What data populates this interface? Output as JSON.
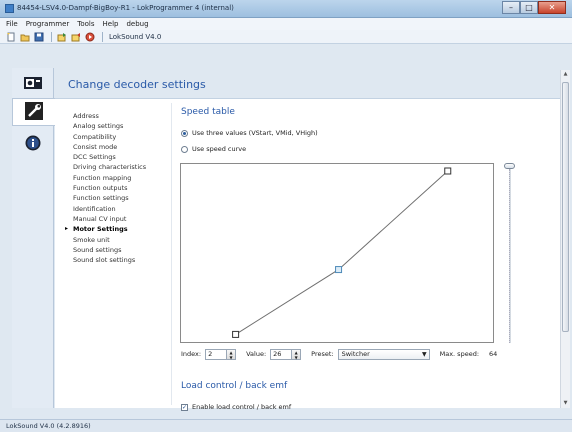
{
  "window": {
    "title": "84454-LSV4.0-Dampf-BigBoy-R1 - LokProgrammer 4 (internal)",
    "controls": [
      "minimize",
      "maximize",
      "close"
    ]
  },
  "menu": [
    "File",
    "Programmer",
    "Tools",
    "Help",
    "debug"
  ],
  "toolbar": {
    "label": "LokSound V4.0",
    "icons": [
      "new-icon",
      "open-icon",
      "save-icon",
      "read-icon",
      "write-icon",
      "run-icon"
    ]
  },
  "rail": {
    "tabs": [
      "decoder-settings-icon",
      "info-icon"
    ]
  },
  "header": {
    "title": "Change decoder settings"
  },
  "nav": {
    "items": [
      "Address",
      "Analog settings",
      "Compatibility",
      "Consist mode",
      "DCC Settings",
      "Driving characteristics",
      "Function mapping",
      "Function outputs",
      "Function settings",
      "Identification",
      "Manual CV input",
      "Motor Settings",
      "Smoke unit",
      "Sound settings",
      "Sound slot settings"
    ],
    "active_index": 11
  },
  "speed_table": {
    "title": "Speed table",
    "option_three_values": "Use three values (VStart, VMid, VHigh)",
    "option_curve": "Use speed curve",
    "selected_option": "three_values",
    "points": [
      {
        "index": 1,
        "value": 1
      },
      {
        "index": 2,
        "value": 26
      },
      {
        "index": 3,
        "value": 64
      }
    ],
    "max_value": 64,
    "index_label": "Index:",
    "index_value": "2",
    "value_label": "Value:",
    "value_value": "26",
    "preset_label": "Preset:",
    "preset_value": "Switcher",
    "max_speed_label": "Max. speed:",
    "max_speed_value": "64"
  },
  "load_control": {
    "title": "Load control / back emf",
    "checkbox_label": "Enable load control / back emf",
    "checked": true
  },
  "status": {
    "text": "LokSound V4.0 (4.2.8916)"
  },
  "colors": {
    "accent": "#2a5aa8",
    "graph_line": "#6f6f6f",
    "point_mid": "#4e8ab8"
  }
}
